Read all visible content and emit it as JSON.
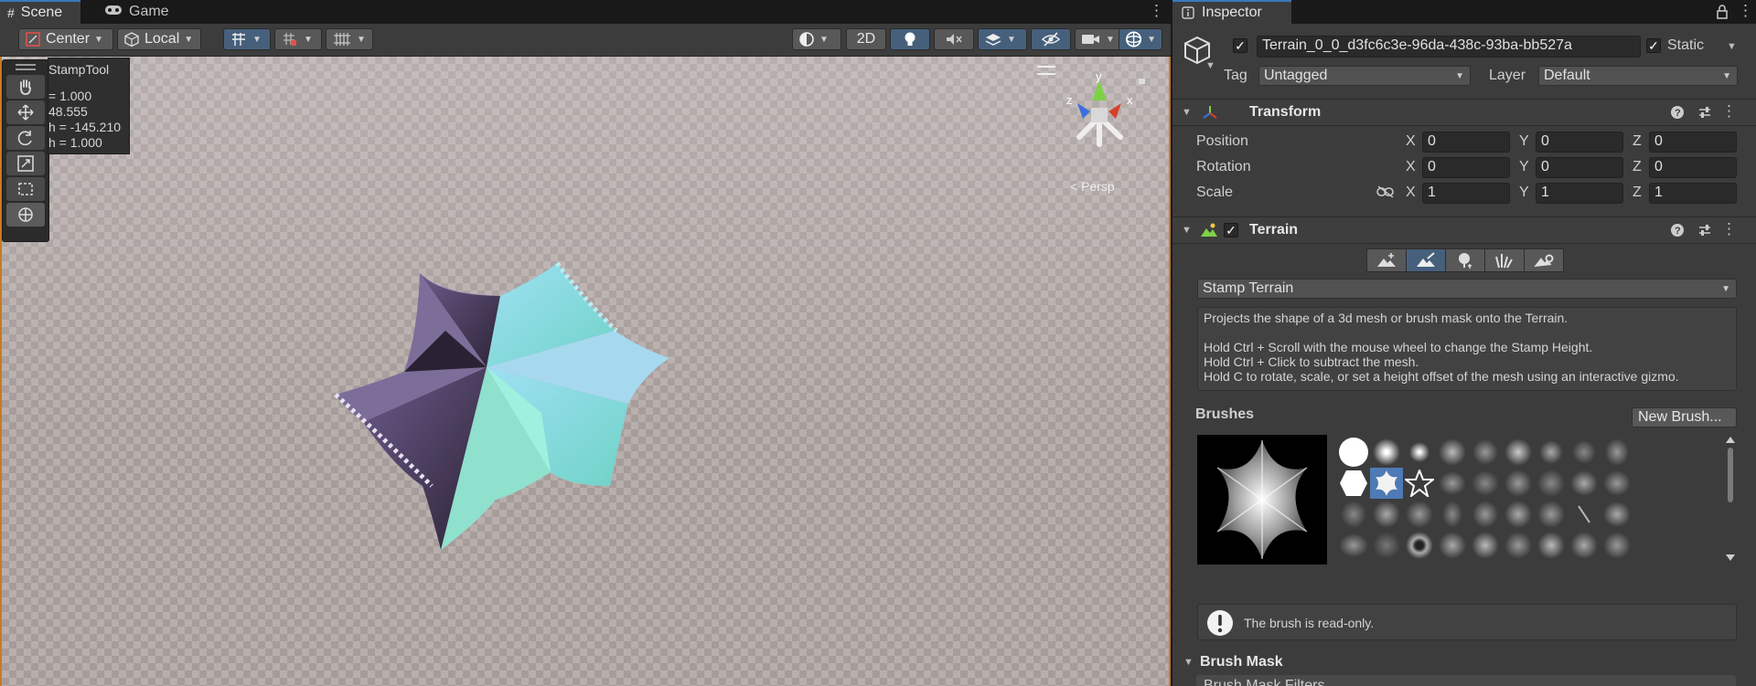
{
  "scene": {
    "tabs": [
      {
        "label": "Scene",
        "icon": "grid-icon",
        "active": true
      },
      {
        "label": "Game",
        "icon": "gamepad-icon",
        "active": false
      }
    ],
    "toolbar": {
      "pivot_label": "Center",
      "space_label": "Local",
      "mode_2d_label": "2D"
    },
    "overlay": {
      "title": "StampTool",
      "lines": [
        "= 1.000",
        "48.555",
        "h = -145.210",
        "h = 1.000"
      ]
    },
    "gizmo": {
      "axis_y": "y",
      "axis_x": "x",
      "axis_z": "z"
    },
    "projection_label": "< Persp"
  },
  "inspector": {
    "tab_label": "Inspector",
    "object": {
      "active": true,
      "name": "Terrain_0_0_d3fc6c3e-96da-438c-93ba-bb527a",
      "static_label": "Static",
      "static": true,
      "tag_label": "Tag",
      "tag_value": "Untagged",
      "layer_label": "Layer",
      "layer_value": "Default"
    },
    "transform": {
      "title": "Transform",
      "position_label": "Position",
      "rotation_label": "Rotation",
      "scale_label": "Scale",
      "axis_x": "X",
      "axis_y": "Y",
      "axis_z": "Z",
      "position": {
        "x": "0",
        "y": "0",
        "z": "0"
      },
      "rotation": {
        "x": "0",
        "y": "0",
        "z": "0"
      },
      "scale": {
        "x": "1",
        "y": "1",
        "z": "1"
      }
    },
    "terrain": {
      "title": "Terrain",
      "enabled": true,
      "tool_dropdown": "Stamp Terrain",
      "help_lines": [
        "Projects the shape of a 3d mesh or brush mask onto the Terrain.",
        "",
        "Hold Ctrl + Scroll with the mouse wheel to change the Stamp Height.",
        "Hold Ctrl + Click to subtract the mesh.",
        "Hold C to rotate, scale, or set a height offset of the mesh using an interactive gizmo."
      ],
      "brushes_label": "Brushes",
      "new_brush_label": "New Brush...",
      "readonly_message": "The brush is read-only.",
      "brush_mask_label": "Brush Mask",
      "brush_mask_filters_label": "Brush Mask Filters"
    }
  },
  "colors": {
    "accent_blue": "#3a79bb",
    "selection_blue": "#46607c",
    "scene_border": "#c77a25"
  }
}
